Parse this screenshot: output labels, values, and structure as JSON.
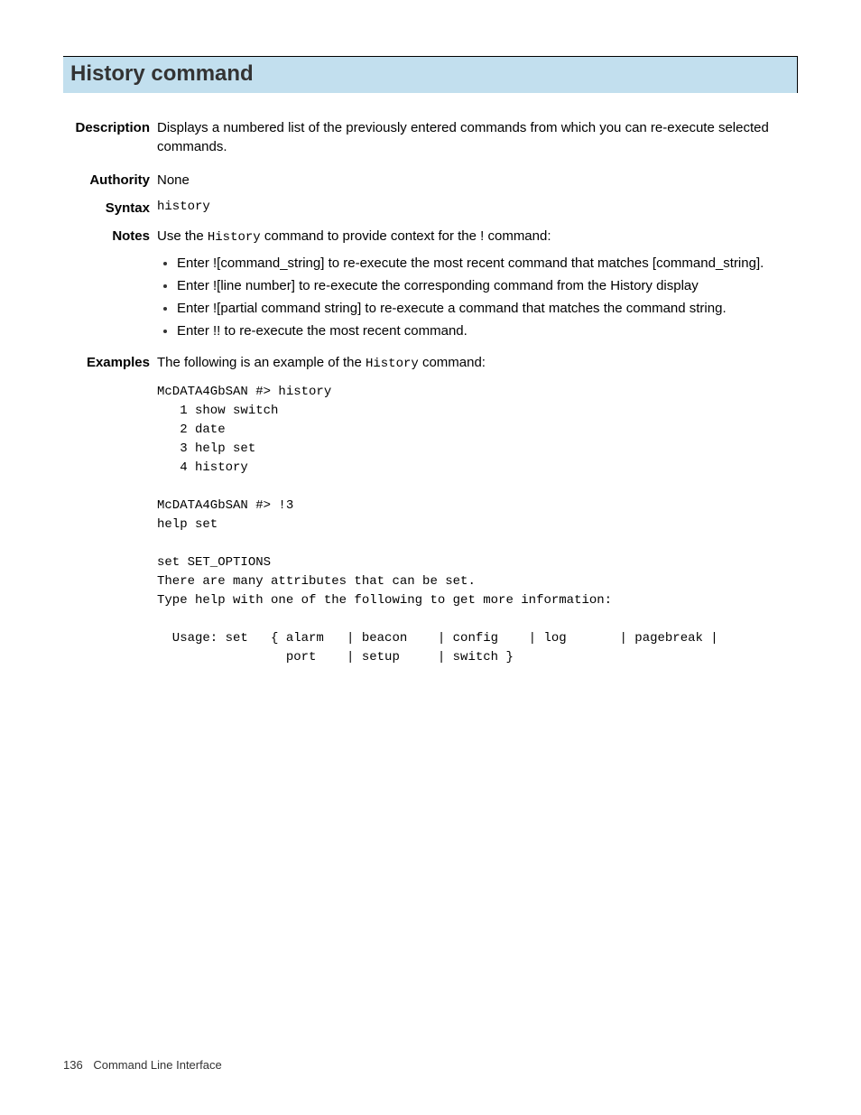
{
  "title": "History command",
  "sections": {
    "description": {
      "label": "Description",
      "text": "Displays a numbered list of the previously entered commands from which you can re-execute selected commands."
    },
    "authority": {
      "label": "Authority",
      "text": "None"
    },
    "syntax": {
      "label": "Syntax",
      "text": "history"
    },
    "notes": {
      "label": "Notes",
      "intro_pre": "Use the ",
      "intro_code": "History",
      "intro_post": " command to provide context for the ! command:",
      "bullets": [
        "Enter ![command_string] to re-execute the most recent command that matches [command_string].",
        "Enter ![line number] to re-execute the corresponding command from the History display",
        "Enter ![partial command string] to re-execute a command that matches the command string.",
        "Enter !! to re-execute the most recent command."
      ]
    },
    "examples": {
      "label": "Examples",
      "intro_pre": "The following is an example of the ",
      "intro_code": "History",
      "intro_post": " command:",
      "code": "McDATA4GbSAN #> history\n   1 show switch\n   2 date\n   3 help set\n   4 history\n\nMcDATA4GbSAN #> !3\nhelp set\n\nset SET_OPTIONS\nThere are many attributes that can be set.\nType help with one of the following to get more information:\n\n  Usage: set   { alarm   | beacon    | config    | log       | pagebreak |\n                 port    | setup     | switch }"
    }
  },
  "footer": {
    "page_number": "136",
    "section": "Command Line Interface"
  }
}
